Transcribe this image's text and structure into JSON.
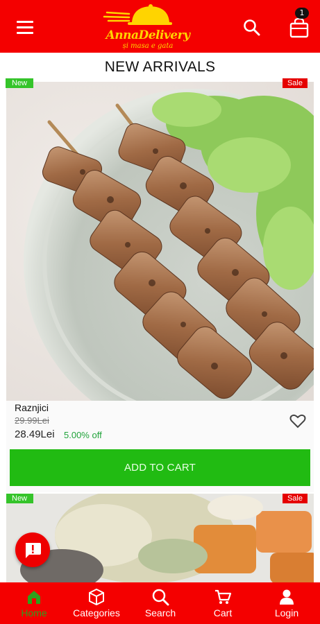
{
  "header": {
    "logo_title": "AnnaDelivery",
    "logo_tagline": "și masa e gata",
    "cart_count": "1"
  },
  "section_title": "NEW ARRIVALS",
  "products": [
    {
      "badge_new": "New",
      "badge_sale": "Sale",
      "name": "Raznjici",
      "old_price": "29.99Lei",
      "price": "28.49Lei",
      "discount": "5.00% off",
      "add_to_cart": "ADD TO CART"
    },
    {
      "badge_new": "New",
      "badge_sale": "Sale"
    }
  ],
  "bottom_nav": {
    "items": [
      {
        "label": "Home",
        "icon": "home-icon",
        "active": true
      },
      {
        "label": "Categories",
        "icon": "cube-icon"
      },
      {
        "label": "Search",
        "icon": "search-icon"
      },
      {
        "label": "Cart",
        "icon": "cart-icon"
      },
      {
        "label": "Login",
        "icon": "user-icon"
      }
    ]
  },
  "colors": {
    "primary_red": "#f40000",
    "brand_yellow": "#ffd400",
    "add_button_green": "#21bb12",
    "active_nav_green": "#2f9f1c",
    "discount_green": "#21a33b"
  }
}
